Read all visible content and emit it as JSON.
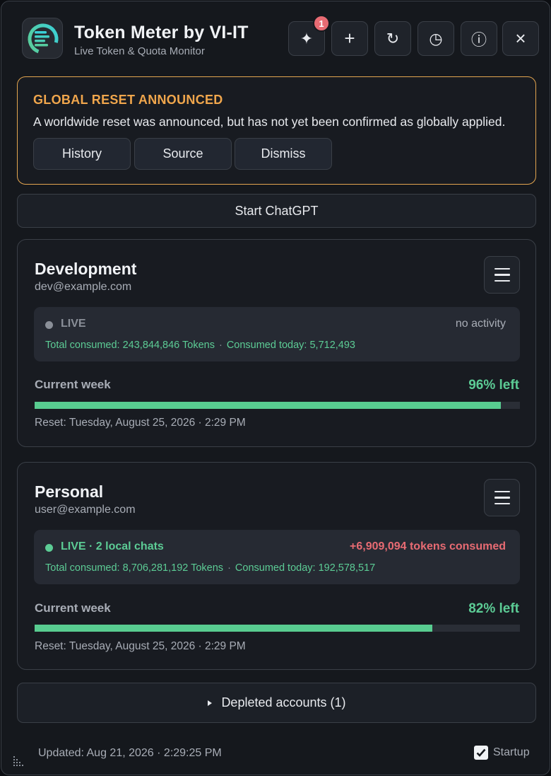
{
  "app": {
    "title": "Token Meter by VI-IT",
    "subtitle": "Live Token & Quota Monitor",
    "icon": "token-meter-logo"
  },
  "toolbar": {
    "sparkle_badge": "1",
    "buttons": [
      {
        "icon": "sparkle-icon",
        "glyph": "✦"
      },
      {
        "icon": "plus-icon",
        "glyph": "+"
      },
      {
        "icon": "refresh-icon",
        "glyph": "↻"
      },
      {
        "icon": "history-clock-icon",
        "glyph": "◷"
      },
      {
        "icon": "info-icon",
        "glyph": "ⓘ"
      },
      {
        "icon": "close-icon",
        "glyph": "×"
      }
    ]
  },
  "alert": {
    "title": "GLOBAL RESET ANNOUNCED",
    "message": "A worldwide reset was announced, but has not yet been confirmed as globally applied.",
    "buttons": [
      "History",
      "Source",
      "Dismiss"
    ],
    "accent": "#f0a64c"
  },
  "start_button": "Start ChatGPT",
  "accounts": [
    {
      "name": "Development",
      "email": "dev@example.com",
      "status": "LIVE",
      "status_color": "#8a8f98",
      "activity": "no activity",
      "activity_color": "#a8adb6",
      "total_consumed": "Total consumed: 243,844,846 Tokens",
      "separator": "·",
      "consumed_today": "Consumed today: 5,712,493",
      "week_label": "Current week",
      "week_left": "96% left",
      "week_fraction": 0.96,
      "reset": "Reset: Tuesday, August 25, 2026 · 2:29 PM"
    },
    {
      "name": "Personal",
      "email": "user@example.com",
      "status": "LIVE · 2 local chats",
      "status_color": "#5ccc95",
      "activity": "+6,909,094 tokens consumed",
      "activity_color": "#e86b73",
      "total_consumed": "Total consumed: 8,706,281,192 Tokens",
      "separator": "·",
      "consumed_today": "Consumed today: 192,578,517",
      "week_label": "Current week",
      "week_left": "82% left",
      "week_fraction": 0.82,
      "reset": "Reset: Tuesday, August 25, 2026 · 2:29 PM"
    }
  ],
  "depleted": {
    "icon": "triangle-right-icon",
    "label": "Depleted accounts (1)"
  },
  "footer": {
    "updated": "Updated: Aug 21, 2026 · 2:29:25 PM",
    "startup_label": "Startup",
    "startup_checked": true
  },
  "colors": {
    "accent_green": "#5ccc95",
    "alert_orange": "#f0a64c",
    "danger_red": "#e86b73"
  }
}
